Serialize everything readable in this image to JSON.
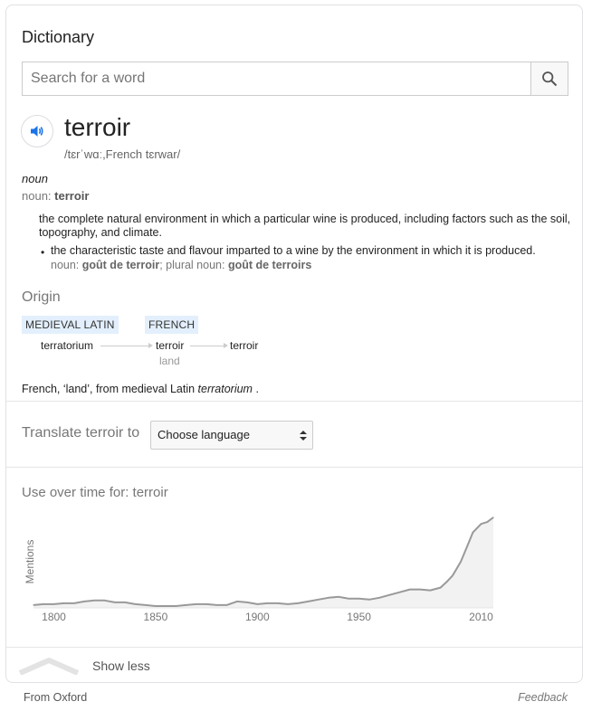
{
  "header": {
    "title": "Dictionary"
  },
  "search": {
    "placeholder": "Search for a word",
    "value": ""
  },
  "entry": {
    "word": "terroir",
    "phonetic": "/tɛrˈwɑː,French tɛrwar/",
    "part_of_speech": "noun",
    "noun_prefix": "noun: ",
    "noun_word": "terroir",
    "definition_1": "the complete natural environment in which a particular wine is produced, including factors such as the soil, topography, and climate.",
    "definition_2": "the characteristic taste and flavour imparted to a wine by the environment in which it is produced.",
    "def2_noun_prefix": "noun: ",
    "def2_noun": "goût de terroir",
    "def2_plural_prefix": "; plural noun: ",
    "def2_plural": "goût de terroirs"
  },
  "origin": {
    "title": "Origin",
    "tags": [
      "MEDIEVAL LATIN",
      "FRENCH"
    ],
    "words": [
      "terratorium",
      "terroir",
      "terroir"
    ],
    "gloss": "land",
    "text_pre": "French, ‘land’, from medieval Latin ",
    "text_italic": "terratorium",
    "text_post": " ."
  },
  "translate": {
    "label": "Translate terroir to",
    "selected": "Choose language"
  },
  "usage": {
    "title": "Use over time for: terroir",
    "ylabel": "Mentions"
  },
  "chart_data": {
    "type": "area",
    "title": "Use over time for: terroir",
    "xlabel": "",
    "ylabel": "Mentions",
    "xlim": [
      1790,
      2016
    ],
    "ylim": [
      0,
      100
    ],
    "x_ticks": [
      1800,
      1850,
      1900,
      1950,
      2010
    ],
    "x": [
      1790,
      1795,
      1800,
      1805,
      1810,
      1815,
      1820,
      1825,
      1830,
      1835,
      1840,
      1845,
      1850,
      1855,
      1860,
      1865,
      1870,
      1875,
      1880,
      1885,
      1890,
      1895,
      1900,
      1905,
      1910,
      1915,
      1920,
      1925,
      1930,
      1935,
      1940,
      1945,
      1950,
      1955,
      1960,
      1965,
      1970,
      1975,
      1980,
      1985,
      1990,
      1993,
      1996,
      2000,
      2003,
      2006,
      2010,
      2013,
      2016
    ],
    "values": [
      3,
      4,
      4,
      5,
      5,
      7,
      8,
      8,
      6,
      6,
      4,
      3,
      2,
      2,
      2,
      3,
      4,
      4,
      3,
      3,
      7,
      6,
      4,
      5,
      5,
      4,
      5,
      7,
      9,
      11,
      12,
      10,
      10,
      9,
      11,
      14,
      17,
      20,
      20,
      19,
      22,
      28,
      35,
      50,
      66,
      82,
      91,
      93,
      98
    ],
    "grid": false,
    "legend": "none",
    "line_color": "#999999",
    "fill_color": "#f2f2f2"
  },
  "footer": {
    "show_less": "Show less",
    "source": "From Oxford",
    "feedback": "Feedback"
  }
}
